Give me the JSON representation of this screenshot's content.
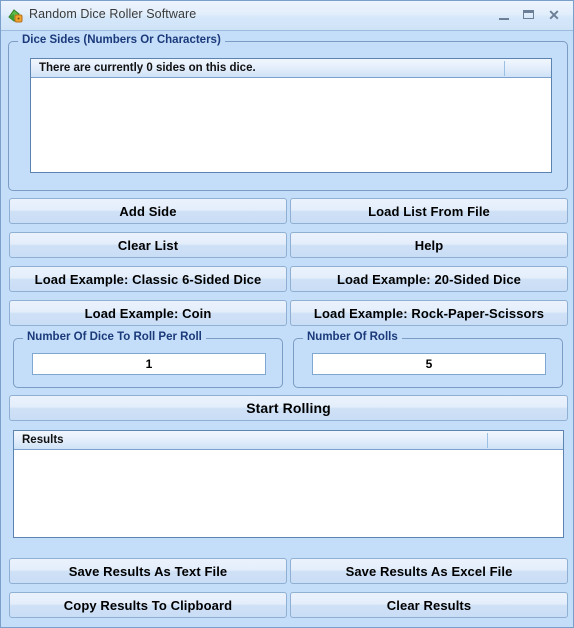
{
  "window": {
    "title": "Random Dice Roller Software",
    "icon": "dice-app-icon",
    "controls": {
      "minimize": "minimize-icon",
      "maximize": "maximize-icon",
      "close": "✕"
    }
  },
  "colors": {
    "window_background": "#c4ddf9",
    "group_title": "#1b3a7a",
    "button_face": "#dceafa",
    "border": "#7b9cc4",
    "listview_border": "#5b84b1"
  },
  "dice_sides_group": {
    "title": "Dice Sides (Numbers Or Characters)",
    "list": {
      "columns": [
        "There are currently 0 sides on this dice.",
        ""
      ],
      "rows": []
    }
  },
  "list_buttons": {
    "add_side": "Add Side",
    "load_list_from_file": "Load List From File",
    "clear_list": "Clear List",
    "help": "Help",
    "example_classic_6": "Load Example: Classic 6-Sided Dice",
    "example_20_sided": "Load Example: 20-Sided Dice",
    "example_coin": "Load Example: Coin",
    "example_rps": "Load Example: Rock-Paper-Scissors"
  },
  "dice_per_roll_group": {
    "title": "Number Of Dice To Roll Per Roll",
    "value": "1",
    "placeholder": ""
  },
  "number_of_rolls_group": {
    "title": "Number Of Rolls",
    "value": "5",
    "placeholder": ""
  },
  "start_rolling_button": "Start Rolling",
  "results_list": {
    "columns": [
      "Results",
      ""
    ],
    "rows": []
  },
  "result_buttons": {
    "save_text": "Save Results As Text File",
    "save_excel": "Save Results As Excel File",
    "copy_clipboard": "Copy Results To Clipboard",
    "clear_results": "Clear Results"
  }
}
